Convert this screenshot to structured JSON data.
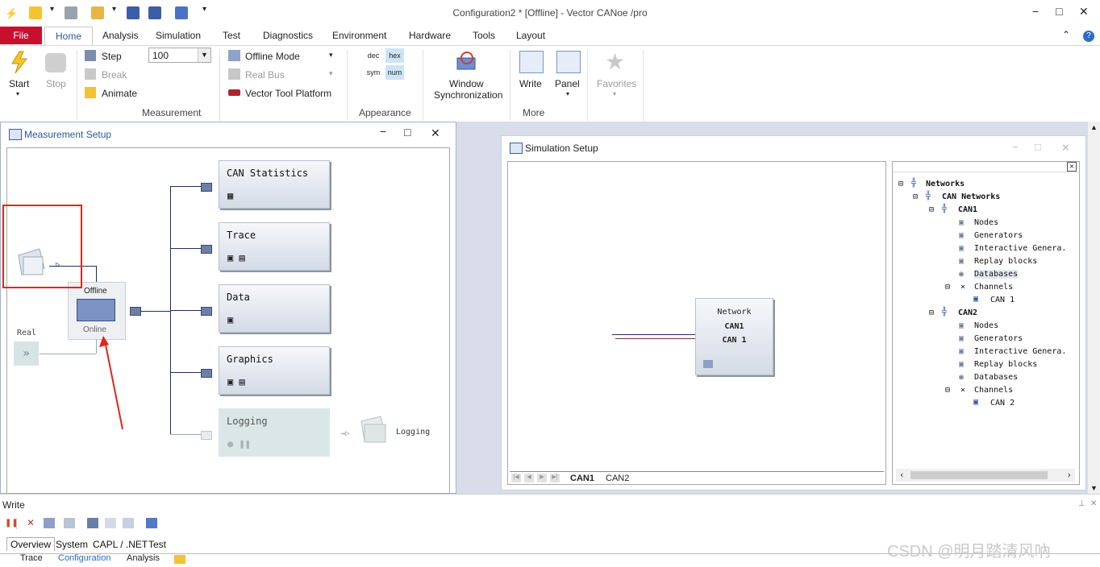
{
  "window": {
    "title": "Configuration2 * [Offline] - Vector CANoe /pro",
    "controls": {
      "minimize": "−",
      "maximize": "□",
      "close": "✕"
    }
  },
  "ribbon": {
    "file_tab": "File",
    "tabs": [
      "Home",
      "Analysis",
      "Simulation",
      "Test",
      "Diagnostics",
      "Environment",
      "Hardware",
      "Tools",
      "Layout"
    ],
    "measurement": {
      "start": "Start",
      "stop": "Stop",
      "step": "Step",
      "break": "Break",
      "animate": "Animate",
      "speed_value": "100",
      "offline_mode": "Offline Mode",
      "real_bus": "Real Bus",
      "vector_tool_platform": "Vector Tool Platform",
      "group_label": "Measurement"
    },
    "appearance": {
      "dec": "dec",
      "hex": "hex",
      "sym": "sym",
      "num": "num",
      "group_label": "Appearance"
    },
    "more": {
      "window_sync_line1": "Window",
      "window_sync_line2": "Synchronization",
      "write": "Write",
      "panel": "Panel",
      "favorites": "Favorites",
      "group_label": "More"
    }
  },
  "measurement_setup": {
    "title": "Measurement Setup",
    "offline_label": "Offline",
    "online_label": "Online",
    "real_label": "Real",
    "real_icon": "»",
    "blocks": [
      "CAN Statistics",
      "Trace",
      "Data",
      "Graphics",
      "Logging"
    ],
    "logging_target": "Logging"
  },
  "simulation_setup": {
    "title": "Simulation Setup",
    "network_block": {
      "line1": "Network",
      "line2": "CAN1",
      "line3": "CAN 1"
    },
    "sheet_tabs": [
      "CAN1",
      "CAN2"
    ],
    "tree": {
      "root": "Networks",
      "can_networks": "CAN Networks",
      "can1": {
        "name": "CAN1",
        "items": [
          "Nodes",
          "Generators",
          "Interactive Genera.",
          "Replay blocks",
          "Databases"
        ],
        "channels": "Channels",
        "channel": "CAN 1"
      },
      "can2": {
        "name": "CAN2",
        "items": [
          "Nodes",
          "Generators",
          "Interactive Genera.",
          "Replay blocks",
          "Databases"
        ],
        "channels": "Channels",
        "channel": "CAN 2"
      }
    }
  },
  "write_pane": {
    "title": "Write",
    "tabs": [
      "Overview",
      "System",
      "CAPL / .NET",
      "Test"
    ]
  },
  "bottom_tabs": [
    "Trace",
    "Configuration",
    "Analysis"
  ],
  "watermark": "CSDN @明月踏清风吶",
  "colors": {
    "file_tab": "#c8102e",
    "accent": "#2b579a",
    "annotation": "#e1261c"
  }
}
